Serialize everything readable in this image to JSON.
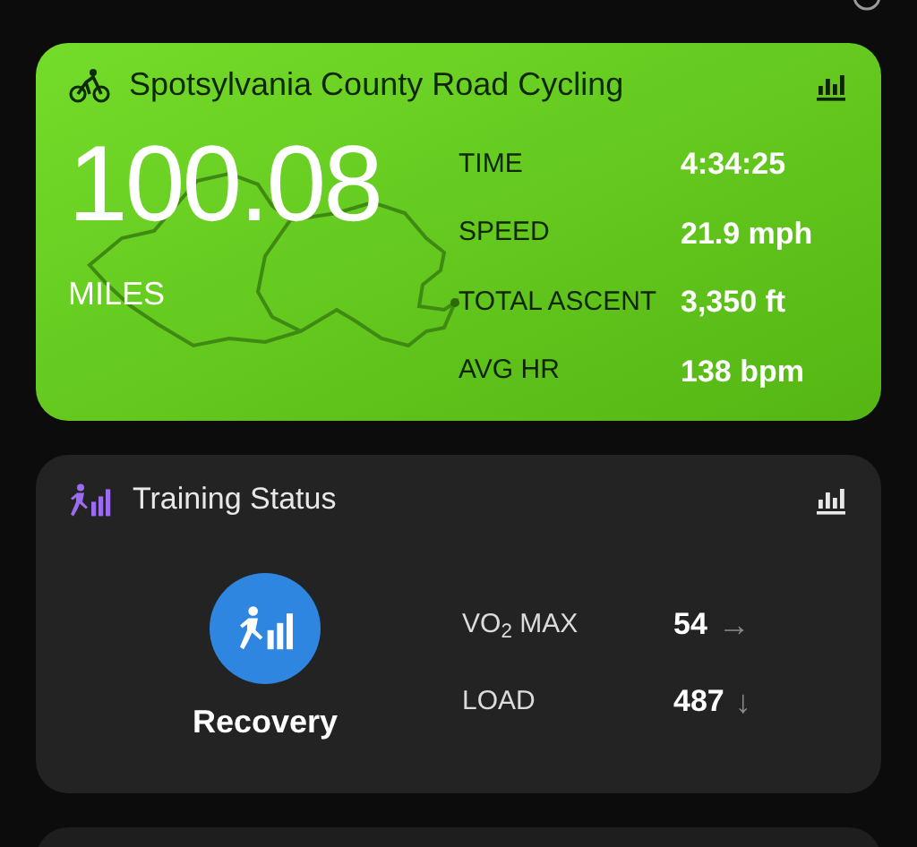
{
  "activity_card": {
    "title": "Spotsylvania County Road Cycling",
    "distance": "100.08",
    "distance_unit": "MILES",
    "stats": [
      {
        "label": "TIME",
        "value": "4:34:25"
      },
      {
        "label": "SPEED",
        "value": "21.9 mph"
      },
      {
        "label": "TOTAL ASCENT",
        "value": "3,350 ft"
      },
      {
        "label": "AVG HR",
        "value": "138 bpm"
      }
    ]
  },
  "training_card": {
    "title": "Training Status",
    "status": "Recovery",
    "metrics": [
      {
        "label": "VO$_{2}$ MAX",
        "value": "54",
        "trend": "→"
      },
      {
        "label": "LOAD",
        "value": "487",
        "trend": "↓"
      }
    ]
  }
}
